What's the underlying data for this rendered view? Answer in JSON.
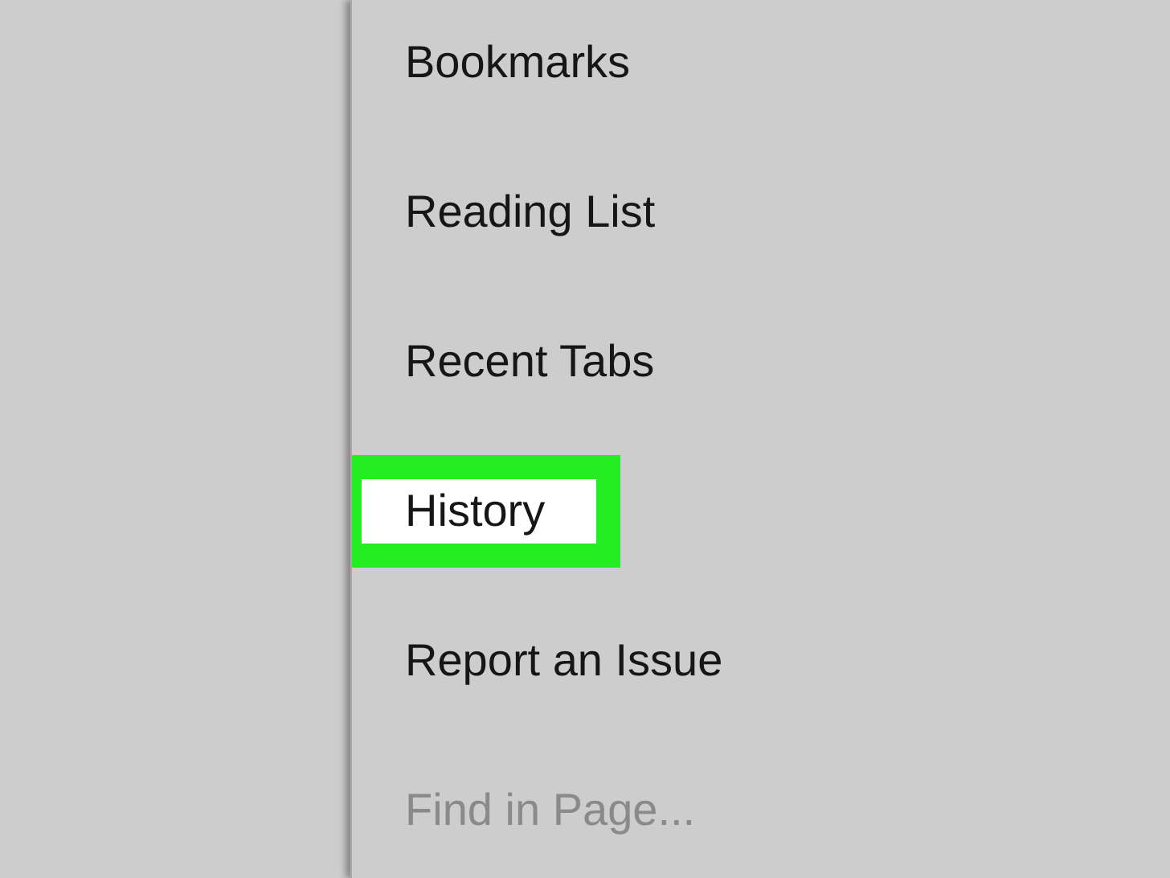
{
  "menu": {
    "items": [
      {
        "label": "Bookmarks",
        "disabled": false,
        "highlighted": false
      },
      {
        "label": "Reading List",
        "disabled": false,
        "highlighted": false
      },
      {
        "label": "Recent Tabs",
        "disabled": false,
        "highlighted": false
      },
      {
        "label": "History",
        "disabled": false,
        "highlighted": true
      },
      {
        "label": "Report an Issue",
        "disabled": false,
        "highlighted": false
      },
      {
        "label": "Find in Page...",
        "disabled": true,
        "highlighted": false
      }
    ]
  }
}
